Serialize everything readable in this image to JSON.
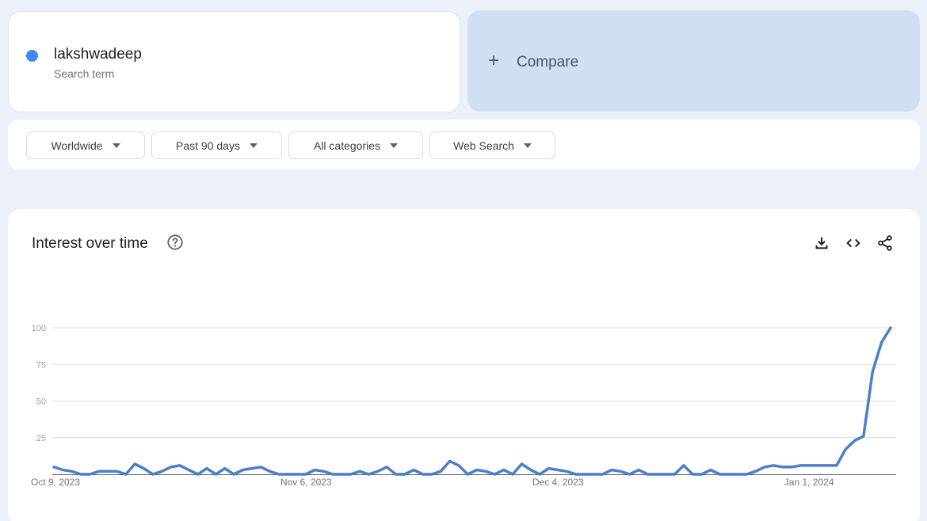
{
  "search_term": {
    "name": "lakshwadeep",
    "subtitle": "Search term",
    "color": "#4285f4"
  },
  "compare": {
    "label": "Compare",
    "icon": "plus-icon"
  },
  "filters": [
    {
      "label": "Worldwide"
    },
    {
      "label": "Past 90 days"
    },
    {
      "label": "All categories"
    },
    {
      "label": "Web Search"
    }
  ],
  "panel": {
    "title": "Interest over time",
    "help_icon": "help-circle-icon",
    "actions": [
      "download-icon",
      "embed-code-icon",
      "share-icon"
    ]
  },
  "chart_data": {
    "type": "line",
    "title": "Interest over time",
    "xlabel": "",
    "ylabel": "",
    "ylim": [
      0,
      100
    ],
    "yticks": [
      25,
      50,
      75,
      100
    ],
    "xtick_labels": [
      {
        "index": 0,
        "label": "Oct 9, 2023"
      },
      {
        "index": 28,
        "label": "Nov 6, 2023"
      },
      {
        "index": 56,
        "label": "Dec 4, 2023"
      },
      {
        "index": 84,
        "label": "Jan 1, 2024"
      }
    ],
    "grid": true,
    "series": [
      {
        "name": "lakshwadeep",
        "color": "#4a7fcb",
        "values": [
          5,
          3,
          2,
          0,
          0,
          2,
          2,
          2,
          0,
          7,
          4,
          0,
          2,
          5,
          6,
          3,
          0,
          4,
          0,
          4,
          0,
          3,
          4,
          5,
          2,
          0,
          0,
          0,
          0,
          3,
          2,
          0,
          0,
          0,
          2,
          0,
          2,
          5,
          0,
          0,
          3,
          0,
          0,
          2,
          9,
          6,
          0,
          3,
          2,
          0,
          3,
          0,
          7,
          3,
          0,
          4,
          3,
          2,
          0,
          0,
          0,
          0,
          3,
          2,
          0,
          3,
          0,
          0,
          0,
          0,
          6,
          0,
          0,
          3,
          0,
          0,
          0,
          0,
          2,
          5,
          6,
          5,
          5,
          6,
          6,
          6,
          6,
          6,
          17,
          23,
          26,
          70,
          90,
          100
        ]
      }
    ]
  }
}
